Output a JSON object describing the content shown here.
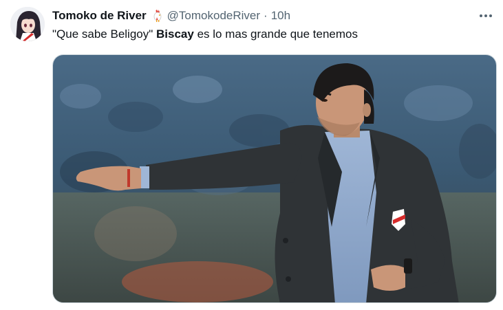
{
  "tweet": {
    "display_name": "Tomoko de River",
    "badge_icon": "rooster-icon",
    "handle": "@TomokodeRiver",
    "separator": "·",
    "time": "10h",
    "text_parts": {
      "quote": "\"Que sabe Beligoy\"",
      "bold": "Biscay",
      "rest": "es lo mas grande que tenemos"
    }
  },
  "colors": {
    "text_primary": "#0f1419",
    "text_secondary": "#536471",
    "border": "#cfd9de"
  }
}
